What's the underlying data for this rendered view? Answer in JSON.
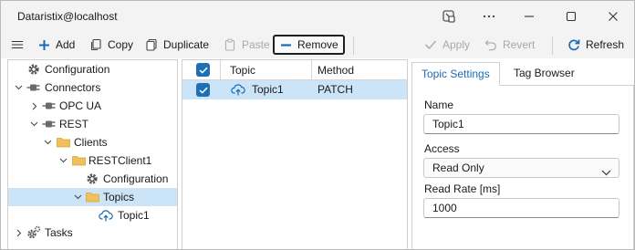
{
  "window": {
    "title": "Dataristix@localhost"
  },
  "toolbar": {
    "menu_icon": "hamburger-menu-icon",
    "add_label": "Add",
    "copy_label": "Copy",
    "duplicate_label": "Duplicate",
    "paste_label": "Paste",
    "remove_label": "Remove",
    "apply_label": "Apply",
    "revert_label": "Revert",
    "refresh_label": "Refresh"
  },
  "tree": {
    "items": [
      {
        "label": "Configuration",
        "icon": "gear-icon",
        "level": 0,
        "expandable": false
      },
      {
        "label": "Connectors",
        "icon": "plug-icon",
        "level": 0,
        "expanded": true
      },
      {
        "label": "OPC UA",
        "icon": "plug-icon",
        "level": 1,
        "expanded": false
      },
      {
        "label": "REST",
        "icon": "plug-icon",
        "level": 1,
        "expanded": true
      },
      {
        "label": "Clients",
        "icon": "folder-icon",
        "level": 2,
        "expanded": true
      },
      {
        "label": "RESTClient1",
        "icon": "folder-icon",
        "level": 3,
        "expanded": true
      },
      {
        "label": "Configuration",
        "icon": "gear-icon",
        "level": 4,
        "expandable": false
      },
      {
        "label": "Topics",
        "icon": "folder-icon",
        "level": 4,
        "expanded": true,
        "selected": true
      },
      {
        "label": "Topic1",
        "icon": "cloud-upload-icon",
        "level": 5,
        "expandable": false
      },
      {
        "label": "Tasks",
        "icon": "gears-icon",
        "level": 0,
        "expanded": false
      }
    ]
  },
  "topics_table": {
    "columns": [
      "Topic",
      "Method"
    ],
    "rows": [
      {
        "topic": "Topic1",
        "method": "PATCH",
        "checked": true
      }
    ]
  },
  "settings": {
    "tabs": [
      "Topic Settings",
      "Tag Browser"
    ],
    "active_tab": "Topic Settings",
    "name_label": "Name",
    "name_value": "Topic1",
    "access_label": "Access",
    "access_value": "Read Only",
    "rate_label": "Read Rate [ms]",
    "rate_value": "1000"
  },
  "colors": {
    "accent": "#1a6bb5",
    "selection": "#cce4f7",
    "checkbox": "#1f6fb5",
    "folder": "#f0c05a",
    "plug": "#6a6a6a"
  }
}
